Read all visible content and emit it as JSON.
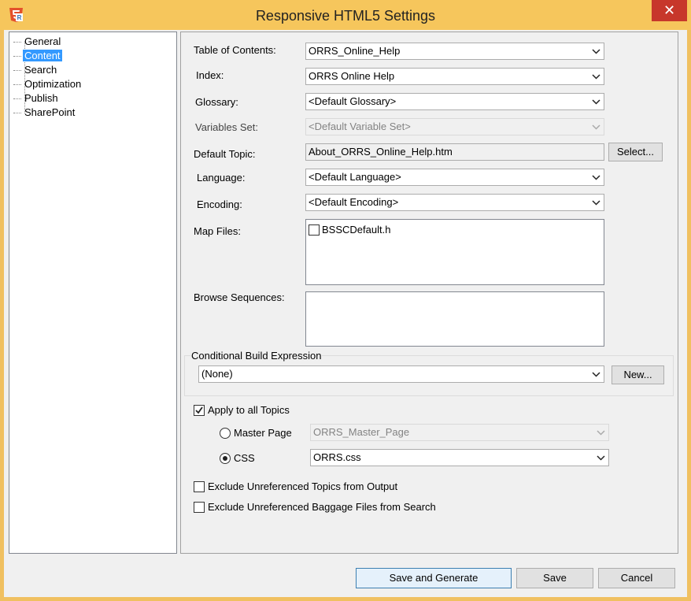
{
  "window": {
    "title": "Responsive HTML5 Settings",
    "close_glyph": "✕",
    "accent": "#f6c65c",
    "close_color": "#c7372b"
  },
  "tree": {
    "items": [
      {
        "label": "General",
        "selected": false
      },
      {
        "label": "Content",
        "selected": true
      },
      {
        "label": "Search",
        "selected": false
      },
      {
        "label": "Optimization",
        "selected": false
      },
      {
        "label": "Publish",
        "selected": false
      },
      {
        "label": "SharePoint",
        "selected": false
      }
    ]
  },
  "content": {
    "toc": {
      "label": "Table of Contents:",
      "value": "ORRS_Online_Help"
    },
    "index": {
      "label": "Index:",
      "value": "ORRS Online Help"
    },
    "glossary": {
      "label": "Glossary:",
      "value": "<Default Glossary>"
    },
    "variables": {
      "label": "Variables Set:",
      "value": "<Default Variable Set>"
    },
    "default_topic": {
      "label": "Default Topic:",
      "value": "About_ORRS_Online_Help.htm",
      "button": "Select..."
    },
    "language": {
      "label": "Language:",
      "value": "<Default Language>"
    },
    "encoding": {
      "label": "Encoding:",
      "value": "<Default Encoding>"
    },
    "map_files": {
      "label": "Map Files:",
      "items": [
        {
          "label": "BSSCDefault.h",
          "checked": false
        }
      ]
    },
    "browse_sequences": {
      "label": "Browse Sequences:"
    },
    "conditional": {
      "label": "Conditional Build Expression",
      "value": "(None)",
      "button": "New..."
    },
    "apply_all": {
      "label": "Apply to all Topics",
      "checked": true
    },
    "master_page": {
      "label": "Master Page",
      "value": "ORRS_Master_Page",
      "selected": false
    },
    "css": {
      "label": "CSS",
      "value": "ORRS.css",
      "selected": true
    },
    "exclude_topics": {
      "label": "Exclude Unreferenced Topics from Output",
      "checked": false
    },
    "exclude_baggage": {
      "label": "Exclude Unreferenced Baggage Files from Search",
      "checked": false
    }
  },
  "footer": {
    "save_generate": "Save and Generate",
    "save": "Save",
    "cancel": "Cancel"
  }
}
